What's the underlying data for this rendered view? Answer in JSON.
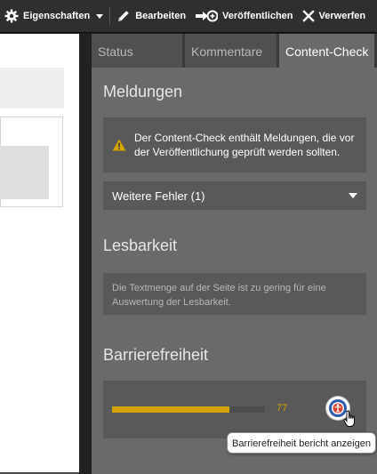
{
  "toolbar": {
    "properties_label": "Eigenschaften",
    "edit_label": "Bearbeiten",
    "publish_label": "Veröffentlichen",
    "discard_label": "Verwerfen"
  },
  "panel": {
    "tabs": [
      {
        "label": "Status",
        "active": false
      },
      {
        "label": "Kommentare",
        "active": false
      },
      {
        "label": "Content-Check",
        "active": true
      }
    ],
    "meldungen": {
      "title": "Meldungen",
      "warning_text": "Der Content-Check enthält Meldungen, die vor der Veröffentlichung geprüft werden sollten.",
      "warning_icon": "warning-triangle-icon",
      "dropdown_label": "Weitere Fehler (1)"
    },
    "lesbarkeit": {
      "title": "Lesbarkeit",
      "text": "Die Textmenge auf der Seite ist zu gering für eine Auswertung der Lesbarkeit."
    },
    "barrierefreiheit": {
      "title": "Barrierefreiheit",
      "score": "77",
      "score_fraction": 0.77,
      "report_icon": "accessibility-icon",
      "tooltip": "Barrierefreiheit bericht anzeigen"
    }
  },
  "colors": {
    "toolbar_bg": "#2f2f2f",
    "panel_bg": "#6a6a6a",
    "card_bg": "#595959",
    "accent_yellow": "#d4a500",
    "accessibility_blue": "#2c5ca8",
    "accessibility_red": "#d9412f"
  }
}
